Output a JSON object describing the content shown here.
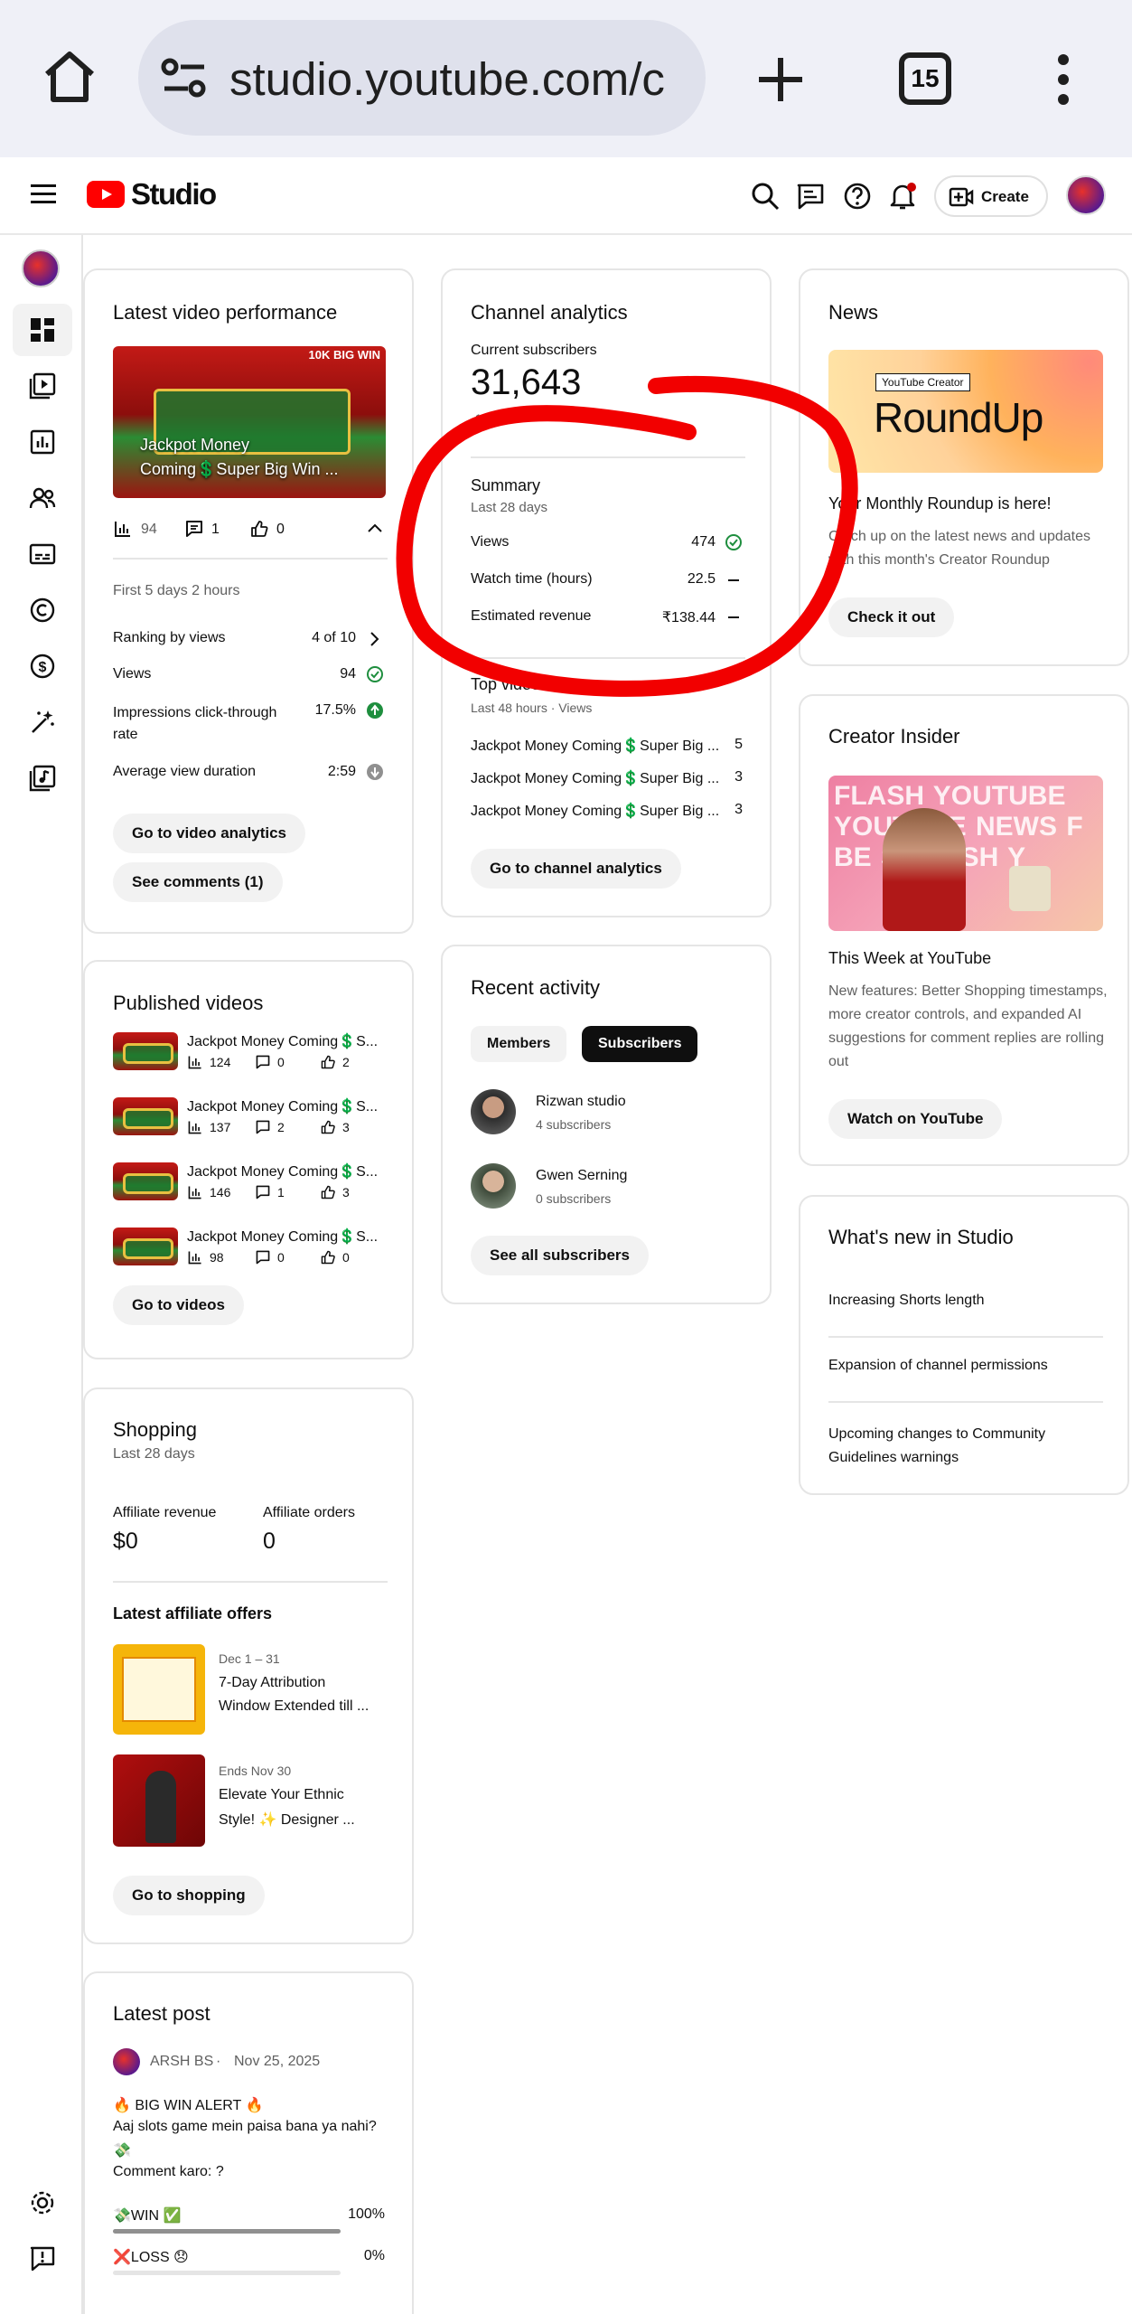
{
  "browser": {
    "url": "studio.youtube.com/c",
    "tab_count": "15"
  },
  "header": {
    "brand": "Studio",
    "create_label": "Create"
  },
  "latest_video": {
    "title": "Latest video performance",
    "thumb_text": "Jackpot Money Coming💲Super Big Win ...",
    "thumb_badge": "10K BIG WIN",
    "views_count": "94",
    "comments_count": "1",
    "likes_count": "0",
    "period": "First 5 days 2 hours",
    "rows": [
      {
        "label": "Ranking by views",
        "value": "4 of 10"
      },
      {
        "label": "Views",
        "value": "94"
      },
      {
        "label": "Impressions click-through rate",
        "value": "17.5%"
      },
      {
        "label": "Average view duration",
        "value": "2:59"
      }
    ],
    "btn_analytics": "Go to video analytics",
    "btn_comments": "See comments (1)"
  },
  "channel_analytics": {
    "title": "Channel analytics",
    "subs_label": "Current subscribers",
    "subs_value": "31,643",
    "subs_change": "-109",
    "summary_title": "Summary",
    "summary_period": "Last 28 days",
    "rows": [
      {
        "label": "Views",
        "value": "474"
      },
      {
        "label": "Watch time (hours)",
        "value": "22.5"
      },
      {
        "label": "Estimated revenue",
        "value": "₹138.44"
      }
    ],
    "top_title": "Top videos",
    "top_period": "Last 48 hours · Views",
    "top_videos": [
      {
        "title": "Jackpot Money Coming💲Super Big ...",
        "views": "5"
      },
      {
        "title": "Jackpot Money Coming💲Super Big ...",
        "views": "3"
      },
      {
        "title": "Jackpot Money Coming💲Super Big ...",
        "views": "3"
      }
    ],
    "btn": "Go to channel analytics"
  },
  "news": {
    "title": "News",
    "badge": "YouTube Creator",
    "banner": "RoundUp",
    "headline": "Your Monthly Roundup is here!",
    "body": "Catch up on the latest news and updates with this month's Creator Roundup",
    "btn": "Check it out"
  },
  "creator_insider": {
    "title": "Creator Insider",
    "banner_text": "FLASH YOUTUBE YOUTUBE NEWS F BE S FLASH Y",
    "headline": "This Week at YouTube",
    "body": "New features: Better Shopping timestamps, more creator controls, and expanded AI suggestions for comment replies are rolling out",
    "btn": "Watch on YouTube"
  },
  "whats_new": {
    "title": "What's new in Studio",
    "items": [
      "Increasing Shorts length",
      "Expansion of channel permissions",
      "Upcoming changes to Community Guidelines warnings"
    ]
  },
  "published_videos": {
    "title": "Published videos",
    "items": [
      {
        "title": "Jackpot Money Coming💲S...",
        "views": "124",
        "comments": "0",
        "likes": "2"
      },
      {
        "title": "Jackpot Money Coming💲S...",
        "views": "137",
        "comments": "2",
        "likes": "3"
      },
      {
        "title": "Jackpot Money Coming💲S...",
        "views": "146",
        "comments": "1",
        "likes": "3"
      },
      {
        "title": "Jackpot Money Coming💲S...",
        "views": "98",
        "comments": "0",
        "likes": "0"
      }
    ],
    "btn": "Go to videos"
  },
  "recent_activity": {
    "title": "Recent activity",
    "tabs": [
      "Members",
      "Subscribers"
    ],
    "subscribers": [
      {
        "name": "Rizwan studio",
        "subs": "4 subscribers"
      },
      {
        "name": "Gwen Serning",
        "subs": "0 subscribers"
      }
    ],
    "btn": "See all subscribers"
  },
  "shopping": {
    "title": "Shopping",
    "period": "Last 28 days",
    "rev_label": "Affiliate revenue",
    "rev_value": "$0",
    "orders_label": "Affiliate orders",
    "orders_value": "0",
    "offers_title": "Latest affiliate offers",
    "offers": [
      {
        "date": "Dec 1 – 31",
        "line1": "7-Day Attribution",
        "line2": "Window Extended till ..."
      },
      {
        "date": "Ends Nov 30",
        "line1": "Elevate Your Ethnic",
        "line2": "Style! ✨ Designer ..."
      }
    ],
    "btn": "Go to shopping"
  },
  "latest_post": {
    "title": "Latest post",
    "author": "ARSH BS",
    "date": "Nov 25, 2025",
    "line1": "🔥 BIG WIN ALERT 🔥",
    "line2": "Aaj slots game mein paisa bana ya nahi?",
    "line3": "💸",
    "line4": "Comment karo: ?",
    "poll": [
      {
        "label": "💸WIN ✅",
        "pct": "100%",
        "fraction": 1.0
      },
      {
        "label": "❌LOSS 😞",
        "pct": "0%",
        "fraction": 0.0
      }
    ]
  },
  "colors": {
    "brand_red": "#ff0000",
    "annotation_red": "#f20000",
    "success_green": "#1e8e3e",
    "fill_bar": "#909090"
  }
}
